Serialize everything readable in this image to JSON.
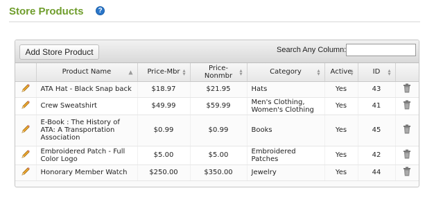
{
  "header": {
    "title": "Store Products",
    "help_icon": "help-icon"
  },
  "toolbar": {
    "add_label": "Add Store Product",
    "search_label": "Search Any Column:",
    "search_value": ""
  },
  "table": {
    "columns": [
      "",
      "Product Name",
      "Price-Mbr",
      "Price-\nNonmbr",
      "Category",
      "Active",
      "ID",
      ""
    ],
    "rows": [
      {
        "name": "ATA Hat - Black Snap back",
        "price_mbr": "$18.97",
        "price_nonmbr": "$21.95",
        "category": "Hats",
        "active": "Yes",
        "id": "43"
      },
      {
        "name": "Crew Sweatshirt",
        "price_mbr": "$49.99",
        "price_nonmbr": "$59.99",
        "category": "Men's Clothing, Women's Clothing",
        "active": "Yes",
        "id": "41"
      },
      {
        "name": "E-Book : The History of ATA: A Transportation Association",
        "price_mbr": "$0.99",
        "price_nonmbr": "$0.99",
        "category": "Books",
        "active": "Yes",
        "id": "45"
      },
      {
        "name": "Embroidered Patch - Full Color Logo",
        "price_mbr": "$5.00",
        "price_nonmbr": "$5.00",
        "category": "Embroidered Patches",
        "active": "Yes",
        "id": "42"
      },
      {
        "name": "Honorary Member Watch",
        "price_mbr": "$250.00",
        "price_nonmbr": "$350.00",
        "category": "Jewelry",
        "active": "Yes",
        "id": "44"
      }
    ]
  },
  "colors": {
    "title": "#6f9d2c",
    "help": "#2a76c9"
  }
}
